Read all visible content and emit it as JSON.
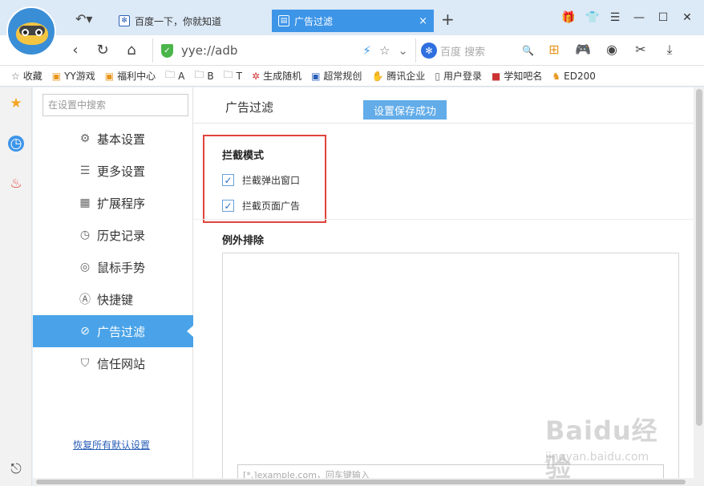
{
  "browser": {
    "tabs": [
      {
        "label": "百度一下，你就知道",
        "favicon": "paw-icon"
      },
      {
        "label": "广告过滤",
        "favicon": "document-icon",
        "close": "×"
      }
    ],
    "url": "yye://adb",
    "search_placeholder": "百度 搜索",
    "bookmarks": [
      {
        "label": "收藏",
        "icon": "star-outline-icon"
      },
      {
        "label": "YY游戏",
        "icon": "tiger-icon"
      },
      {
        "label": "福利中心",
        "icon": "tiger-icon"
      },
      {
        "label": "A",
        "icon": "folder-icon"
      },
      {
        "label": "B",
        "icon": "folder-icon"
      },
      {
        "label": "T",
        "icon": "folder-icon"
      },
      {
        "label": "生成随机",
        "icon": "random-icon"
      },
      {
        "label": "超常规创",
        "icon": "paw-icon"
      },
      {
        "label": "腾讯企业",
        "icon": "hand-icon"
      },
      {
        "label": "用户登录",
        "icon": "page-icon"
      },
      {
        "label": "学知吧名",
        "icon": "xue-icon"
      },
      {
        "label": "ED200",
        "icon": "horse-icon"
      }
    ]
  },
  "sidebar": {
    "search_placeholder": "在设置中搜索",
    "items": [
      {
        "label": "基本设置",
        "icon": "gear-icon"
      },
      {
        "label": "更多设置",
        "icon": "list-icon"
      },
      {
        "label": "扩展程序",
        "icon": "grid-icon"
      },
      {
        "label": "历史记录",
        "icon": "clock-icon"
      },
      {
        "label": "鼠标手势",
        "icon": "gesture-icon"
      },
      {
        "label": "快捷键",
        "icon": "a-key-icon"
      },
      {
        "label": "广告过滤",
        "icon": "block-icon",
        "active": true
      },
      {
        "label": "信任网站",
        "icon": "shield-icon"
      }
    ],
    "restore_link": "恢复所有默认设置"
  },
  "main": {
    "title": "广告过滤",
    "toast": "设置保存成功",
    "block_mode": {
      "heading": "拦截模式",
      "options": [
        {
          "label": "拦截弹出窗口",
          "checked": true
        },
        {
          "label": "拦截页面广告",
          "checked": true
        }
      ]
    },
    "exclusion": {
      "heading": "例外排除",
      "input_placeholder": "[*.]example.com，回车键输入"
    }
  },
  "watermark": {
    "logo": "Baidu经验",
    "sub": "jingyan.baidu.com"
  },
  "colors": {
    "accent": "#4aa3e8",
    "active_tab": "#3d95e8",
    "highlight_box": "#e0443c",
    "toast": "#62ace9"
  }
}
